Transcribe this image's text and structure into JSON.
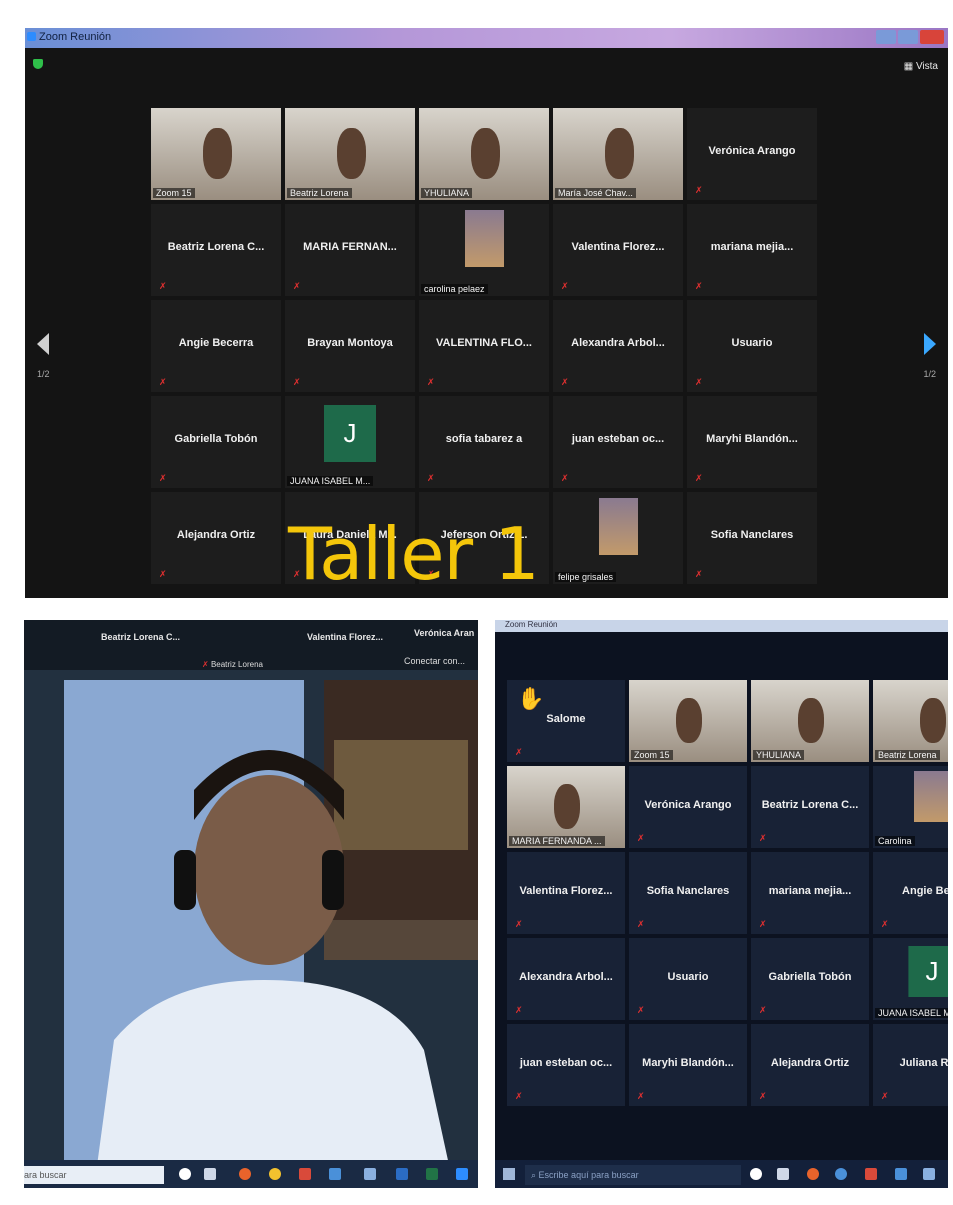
{
  "top": {
    "window_title": "Zoom Reunión",
    "view_label": "Vista",
    "page_left": "1/2",
    "page_right": "1/2",
    "tiles": [
      {
        "name": "Zoom 15",
        "type": "video"
      },
      {
        "name": "Beatriz Lorena",
        "type": "video"
      },
      {
        "name": "YHULIANA",
        "type": "video"
      },
      {
        "name": "María José Chav...",
        "type": "video"
      },
      {
        "name": "Verónica Arango",
        "type": "text"
      },
      {
        "name": "Beatriz Lorena C...",
        "type": "text"
      },
      {
        "name": "MARIA FERNAN...",
        "type": "text"
      },
      {
        "name": "carolina pelaez",
        "type": "image"
      },
      {
        "name": "Valentina Florez...",
        "type": "text"
      },
      {
        "name": "mariana mejia...",
        "type": "text"
      },
      {
        "name": "Angie Becerra",
        "type": "text"
      },
      {
        "name": "Brayan Montoya",
        "type": "text"
      },
      {
        "name": "VALENTINA FLO...",
        "type": "text"
      },
      {
        "name": "Alexandra Arbol...",
        "type": "text"
      },
      {
        "name": "Usuario",
        "type": "text"
      },
      {
        "name": "Gabriella Tobón",
        "type": "text"
      },
      {
        "name": "JUANA ISABEL M...",
        "type": "avatar",
        "initial": "J"
      },
      {
        "name": "sofia tabarez a",
        "type": "text"
      },
      {
        "name": "juan esteban oc...",
        "type": "text"
      },
      {
        "name": "Maryhi Blandón...",
        "type": "text"
      },
      {
        "name": "Alejandra Ortiz",
        "type": "text"
      },
      {
        "name": "Laura Daniela M...",
        "type": "text"
      },
      {
        "name": "Jeferson Ortiz L.",
        "type": "text"
      },
      {
        "name": "felipe grisales",
        "type": "image"
      },
      {
        "name": "Sofia Nanclares",
        "type": "text"
      }
    ]
  },
  "overlay_text": "Taller 1",
  "bottom_left": {
    "header_names": [
      "Beatriz Lorena C...",
      "Valentina Florez...",
      "Verónica Aran"
    ],
    "sub_label": "Beatriz Lorena",
    "connect_label": "Conectar con...",
    "search_placeholder": "ara buscar"
  },
  "bottom_right": {
    "window_title": "Zoom Reunión",
    "tiles": [
      {
        "name": "Salome",
        "type": "text"
      },
      {
        "name": "Zoom 15",
        "type": "video"
      },
      {
        "name": "YHULIANA",
        "type": "video"
      },
      {
        "name": "Beatriz Lorena",
        "type": "video"
      },
      {
        "name": "MARIA FERNANDA ...",
        "type": "video"
      },
      {
        "name": "Verónica Arango",
        "type": "text"
      },
      {
        "name": "Beatriz Lorena C...",
        "type": "text"
      },
      {
        "name": "Carolina",
        "type": "image"
      },
      {
        "name": "Valentina Florez...",
        "type": "text"
      },
      {
        "name": "Sofia Nanclares",
        "type": "text"
      },
      {
        "name": "mariana mejia...",
        "type": "text"
      },
      {
        "name": "Angie Bece",
        "type": "text"
      },
      {
        "name": "Alexandra Arbol...",
        "type": "text"
      },
      {
        "name": "Usuario",
        "type": "text"
      },
      {
        "name": "Gabriella Tobón",
        "type": "text"
      },
      {
        "name": "JUANA ISABEL M",
        "type": "avatar",
        "initial": "J"
      },
      {
        "name": "juan esteban oc...",
        "type": "text"
      },
      {
        "name": "Maryhi Blandón...",
        "type": "text"
      },
      {
        "name": "Alejandra Ortiz",
        "type": "text"
      },
      {
        "name": "Juliana Ram",
        "type": "text"
      }
    ],
    "search_placeholder": "Escribe aquí para buscar"
  },
  "colors": {
    "accent": "#2d8cff",
    "overlay": "#f4c60a",
    "active_border": "#c8e060",
    "mic_off": "#e03030"
  }
}
